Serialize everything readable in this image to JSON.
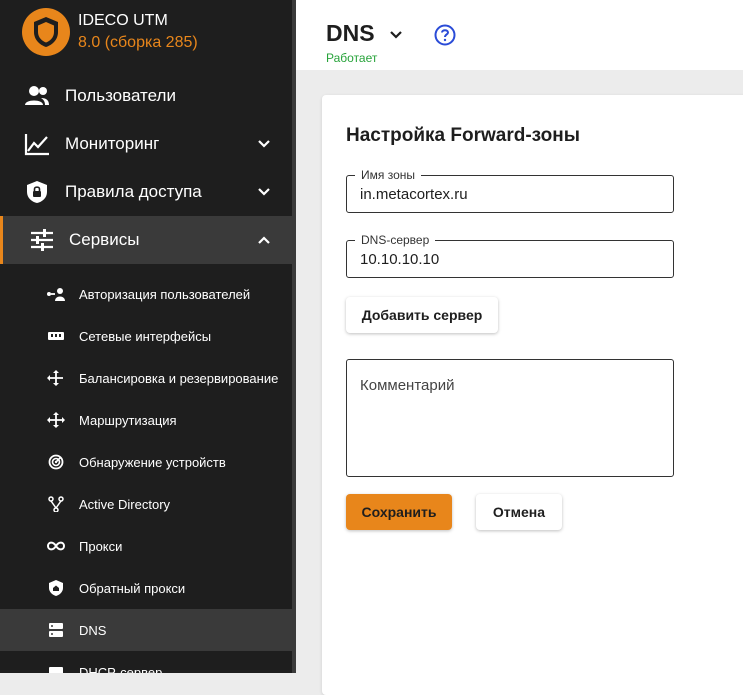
{
  "brand": {
    "name": "IDECO UTM",
    "version": "8.0 (сборка 285)",
    "accent": "#e8861b"
  },
  "nav": {
    "users": "Пользователи",
    "monitoring": "Мониторинг",
    "access_rules": "Правила доступа",
    "services": "Сервисы"
  },
  "subnav": {
    "user_auth": "Авторизация пользователей",
    "net_interfaces": "Сетевые интерфейсы",
    "balancing": "Балансировка и резервирование",
    "routing": "Маршрутизация",
    "device_discovery": "Обнаружение устройств",
    "active_directory": "Active Directory",
    "proxy": "Прокси",
    "reverse_proxy": "Обратный прокси",
    "dns": "DNS",
    "dhcp": "DHCP-сервер"
  },
  "header": {
    "title": "DNS",
    "status": "Работает",
    "status_color": "#27a33a"
  },
  "form": {
    "title": "Настройка Forward-зоны",
    "zone_label": "Имя зоны",
    "zone_value": "in.metacortex.ru",
    "dns_label": "DNS-сервер",
    "dns_value": "10.10.10.10",
    "add_server": "Добавить сервер",
    "comment_placeholder": "Комментарий",
    "save": "Сохранить",
    "cancel": "Отмена"
  }
}
